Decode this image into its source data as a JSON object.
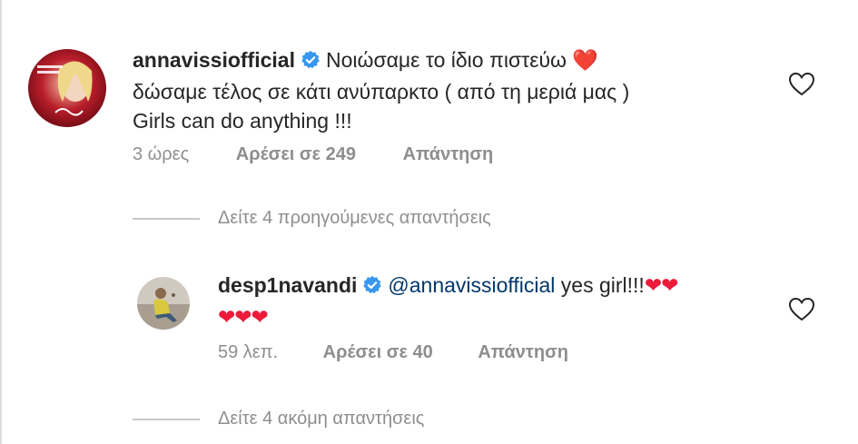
{
  "comments": [
    {
      "username": "annavissiofficial",
      "text_line1": "Νοιώσαμε το ίδιο πιστεύω",
      "text_line1_emoji": "❤️",
      "text_line2": "δώσαμε τέλος σε κάτι ανύπαρκτο ( από τη μεριά μας )",
      "text_line3": "Girls can do anything !!!",
      "time": "3 ώρες",
      "likes": "Αρέσει σε 249",
      "reply": "Απάντηση",
      "avatar_icon": "concert-poster-avatar"
    },
    {
      "username": "desp1navandi",
      "mention": "@annavissiofficial",
      "text": "yes girl!!!",
      "hearts_line1": "❤❤",
      "hearts_line2": "❤❤❤",
      "time": "59 λεπ.",
      "likes": "Αρέσει σε 40",
      "reply": "Απάντηση",
      "avatar_icon": "person-sitting-avatar"
    }
  ],
  "view_replies": [
    "Δείτε 4 προηγούμενες απαντήσεις",
    "Δείτε 4 ακόμη απαντήσεις"
  ],
  "icons": {
    "verified": "verified-badge-icon",
    "like": "heart-outline-icon"
  },
  "colors": {
    "text": "#262626",
    "secondary": "#8e8e8e",
    "verified": "#3897f0",
    "mention": "#00376b",
    "heart": "#ed1a3a"
  }
}
